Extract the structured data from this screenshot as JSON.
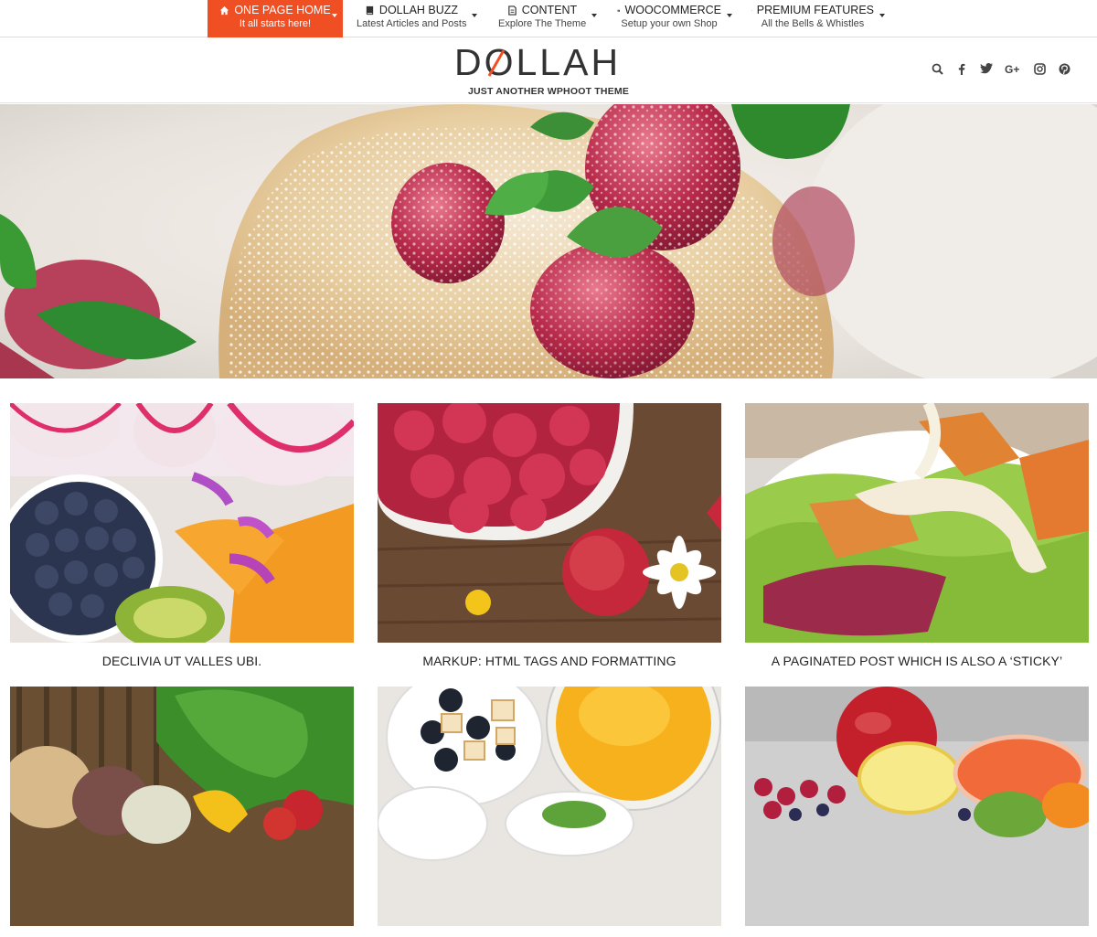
{
  "nav": {
    "items": [
      {
        "title": "ONE PAGE HOME",
        "subtitle": "It all starts here!",
        "icon": "home-icon"
      },
      {
        "title": "DOLLAH BUZZ",
        "subtitle": "Latest Articles and Posts",
        "icon": "book-icon"
      },
      {
        "title": "CONTENT",
        "subtitle": "Explore The Theme",
        "icon": "file-icon"
      },
      {
        "title": "WOOCOMMERCE",
        "subtitle": "Setup your own Shop",
        "icon": "gift-icon"
      },
      {
        "title": "PREMIUM FEATURES",
        "subtitle": "All the Bells & Whistles",
        "icon": "trophy-icon"
      }
    ],
    "active_color": "#f04e23"
  },
  "header": {
    "logo_text": "DOLLAH",
    "tagline": "JUST ANOTHER WPHOOT THEME",
    "social_icons": [
      "search-icon",
      "facebook-icon",
      "twitter-icon",
      "google-plus-icon",
      "instagram-icon",
      "pinterest-icon"
    ]
  },
  "posts": [
    {
      "title": "DECLIVIA UT VALLES UBI."
    },
    {
      "title": "MARKUP: HTML TAGS AND FORMATTING"
    },
    {
      "title": "A PAGINATED POST WHICH IS ALSO A ‘STICKY’"
    },
    {
      "title": ""
    },
    {
      "title": ""
    },
    {
      "title": ""
    }
  ]
}
